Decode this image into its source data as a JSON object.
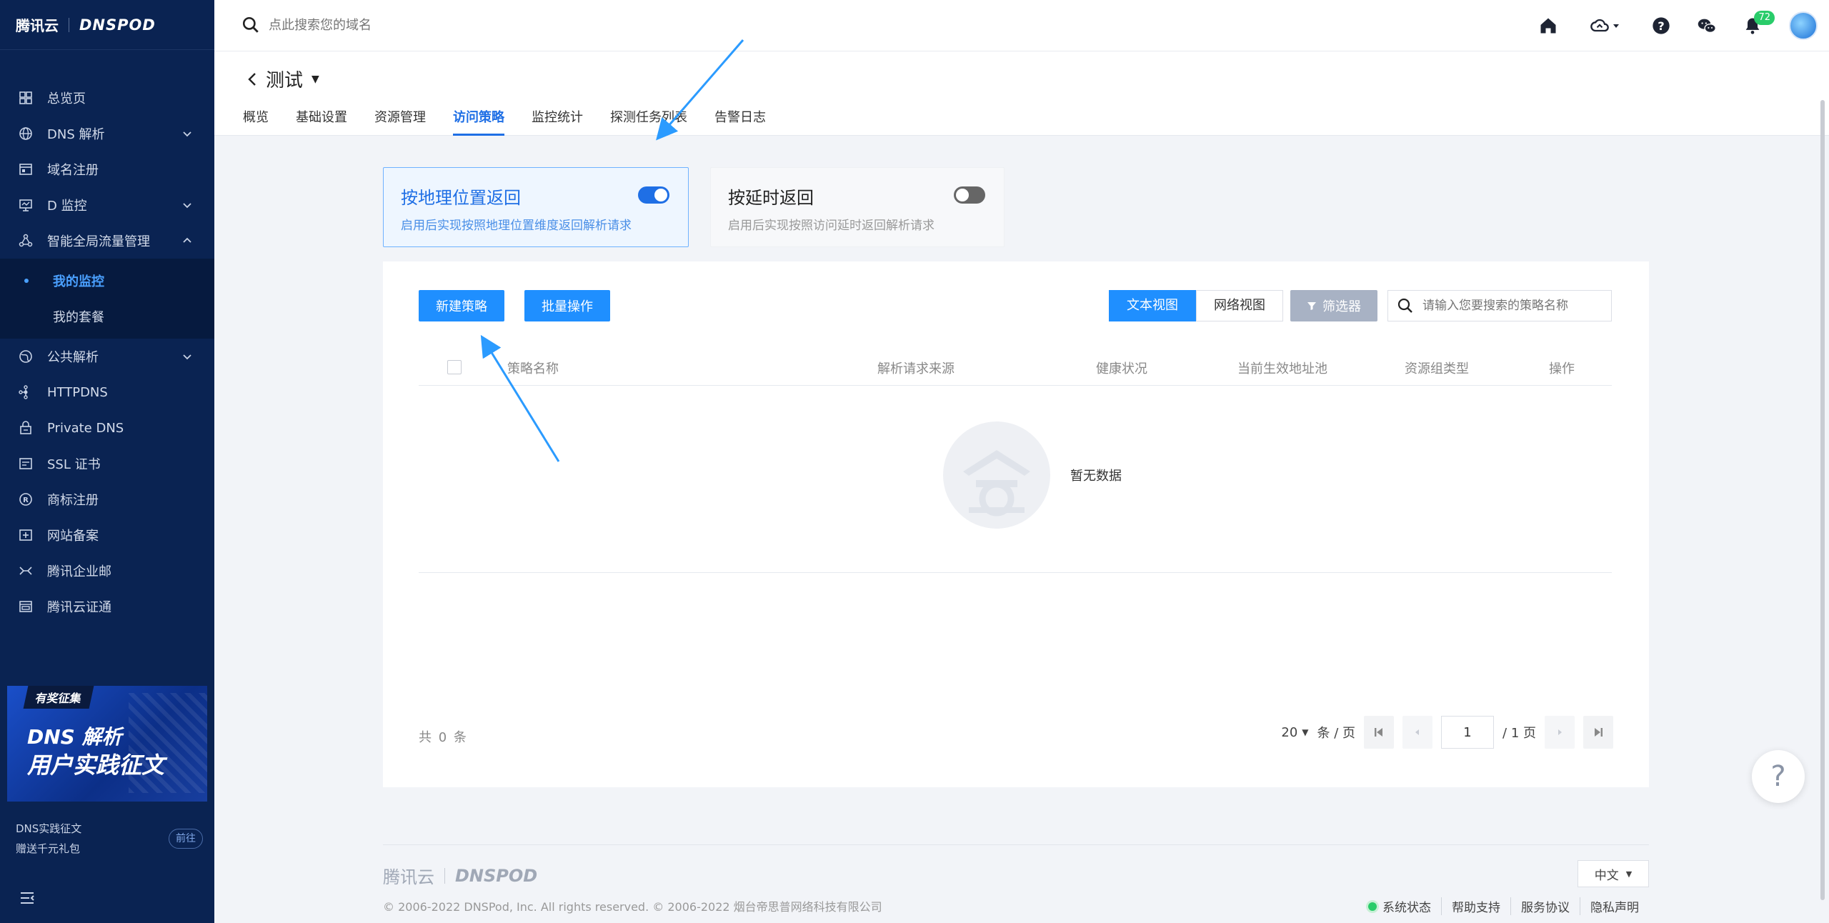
{
  "brand": {
    "cloud": "腾讯云",
    "product": "DNSPOD"
  },
  "sidebar": {
    "items": [
      {
        "label": "总览页",
        "icon": "dashboard-icon"
      },
      {
        "label": "DNS 解析",
        "icon": "globe-icon",
        "chevron": "down"
      },
      {
        "label": "域名注册",
        "icon": "domain-icon"
      },
      {
        "label": "D 监控",
        "icon": "monitor-icon",
        "chevron": "down"
      },
      {
        "label": "智能全局流量管理",
        "icon": "traffic-icon",
        "chevron": "up"
      }
    ],
    "subitems": [
      {
        "label": "我的监控",
        "active": true
      },
      {
        "label": "我的套餐",
        "active": false
      }
    ],
    "items2": [
      {
        "label": "公共解析",
        "icon": "public-dns-icon",
        "chevron": "down"
      },
      {
        "label": "HTTPDNS",
        "icon": "httpdns-icon"
      },
      {
        "label": "Private DNS",
        "icon": "private-dns-icon"
      },
      {
        "label": "SSL 证书",
        "icon": "ssl-icon"
      },
      {
        "label": "商标注册",
        "icon": "trademark-icon"
      },
      {
        "label": "网站备案",
        "icon": "icp-icon"
      },
      {
        "label": "腾讯企业邮",
        "icon": "mail-icon"
      },
      {
        "label": "腾讯云证通",
        "icon": "cert-icon"
      }
    ],
    "promo": {
      "tag": "有奖征集",
      "line1": "DNS 解析",
      "line2": "用户实践征文"
    },
    "cta": {
      "line1": "DNS实践征文",
      "line2": "赠送千元礼包",
      "button": "前往"
    }
  },
  "topbar": {
    "search_placeholder": "点此搜索您的域名",
    "notification_count": "72"
  },
  "page": {
    "title": "测试",
    "tabs": [
      "概览",
      "基础设置",
      "资源管理",
      "访问策略",
      "监控统计",
      "探测任务列表",
      "告警日志"
    ],
    "active_tab": 3
  },
  "strategies": {
    "geo": {
      "title": "按地理位置返回",
      "desc": "启用后实现按照地理位置维度返回解析请求",
      "enabled": true
    },
    "latency": {
      "title": "按延时返回",
      "desc": "启用后实现按照访问延时返回解析请求",
      "enabled": false
    }
  },
  "toolbar": {
    "new_label": "新建策略",
    "batch_label": "批量操作",
    "text_view": "文本视图",
    "network_view": "网络视图",
    "filter_label": "筛选器",
    "search_placeholder": "请输入您要搜索的策略名称"
  },
  "table": {
    "columns": [
      "策略名称",
      "解析请求来源",
      "健康状况",
      "当前生效地址池",
      "资源组类型",
      "操作"
    ],
    "empty_text": "暂无数据"
  },
  "pagination": {
    "total": "共 0 条",
    "page_size": "20",
    "per_page_label": "条 / 页",
    "current_page": "1",
    "total_pages": "/ 1 页"
  },
  "footer": {
    "logo_cloud": "腾讯云",
    "logo_product": "DNSPOD",
    "copyright": "© 2006-2022 DNSPod, Inc. All rights reserved. © 2006-2022 烟台帝思普网络科技有限公司",
    "language": "中文",
    "links": [
      "系统状态",
      "帮助支持",
      "服务协议",
      "隐私声明"
    ]
  },
  "help_label": "?",
  "colors": {
    "sidebar_bg": "#0a2352",
    "primary": "#1f8fff",
    "accent": "#1f6fe5",
    "status_ok": "#29cc6a"
  }
}
